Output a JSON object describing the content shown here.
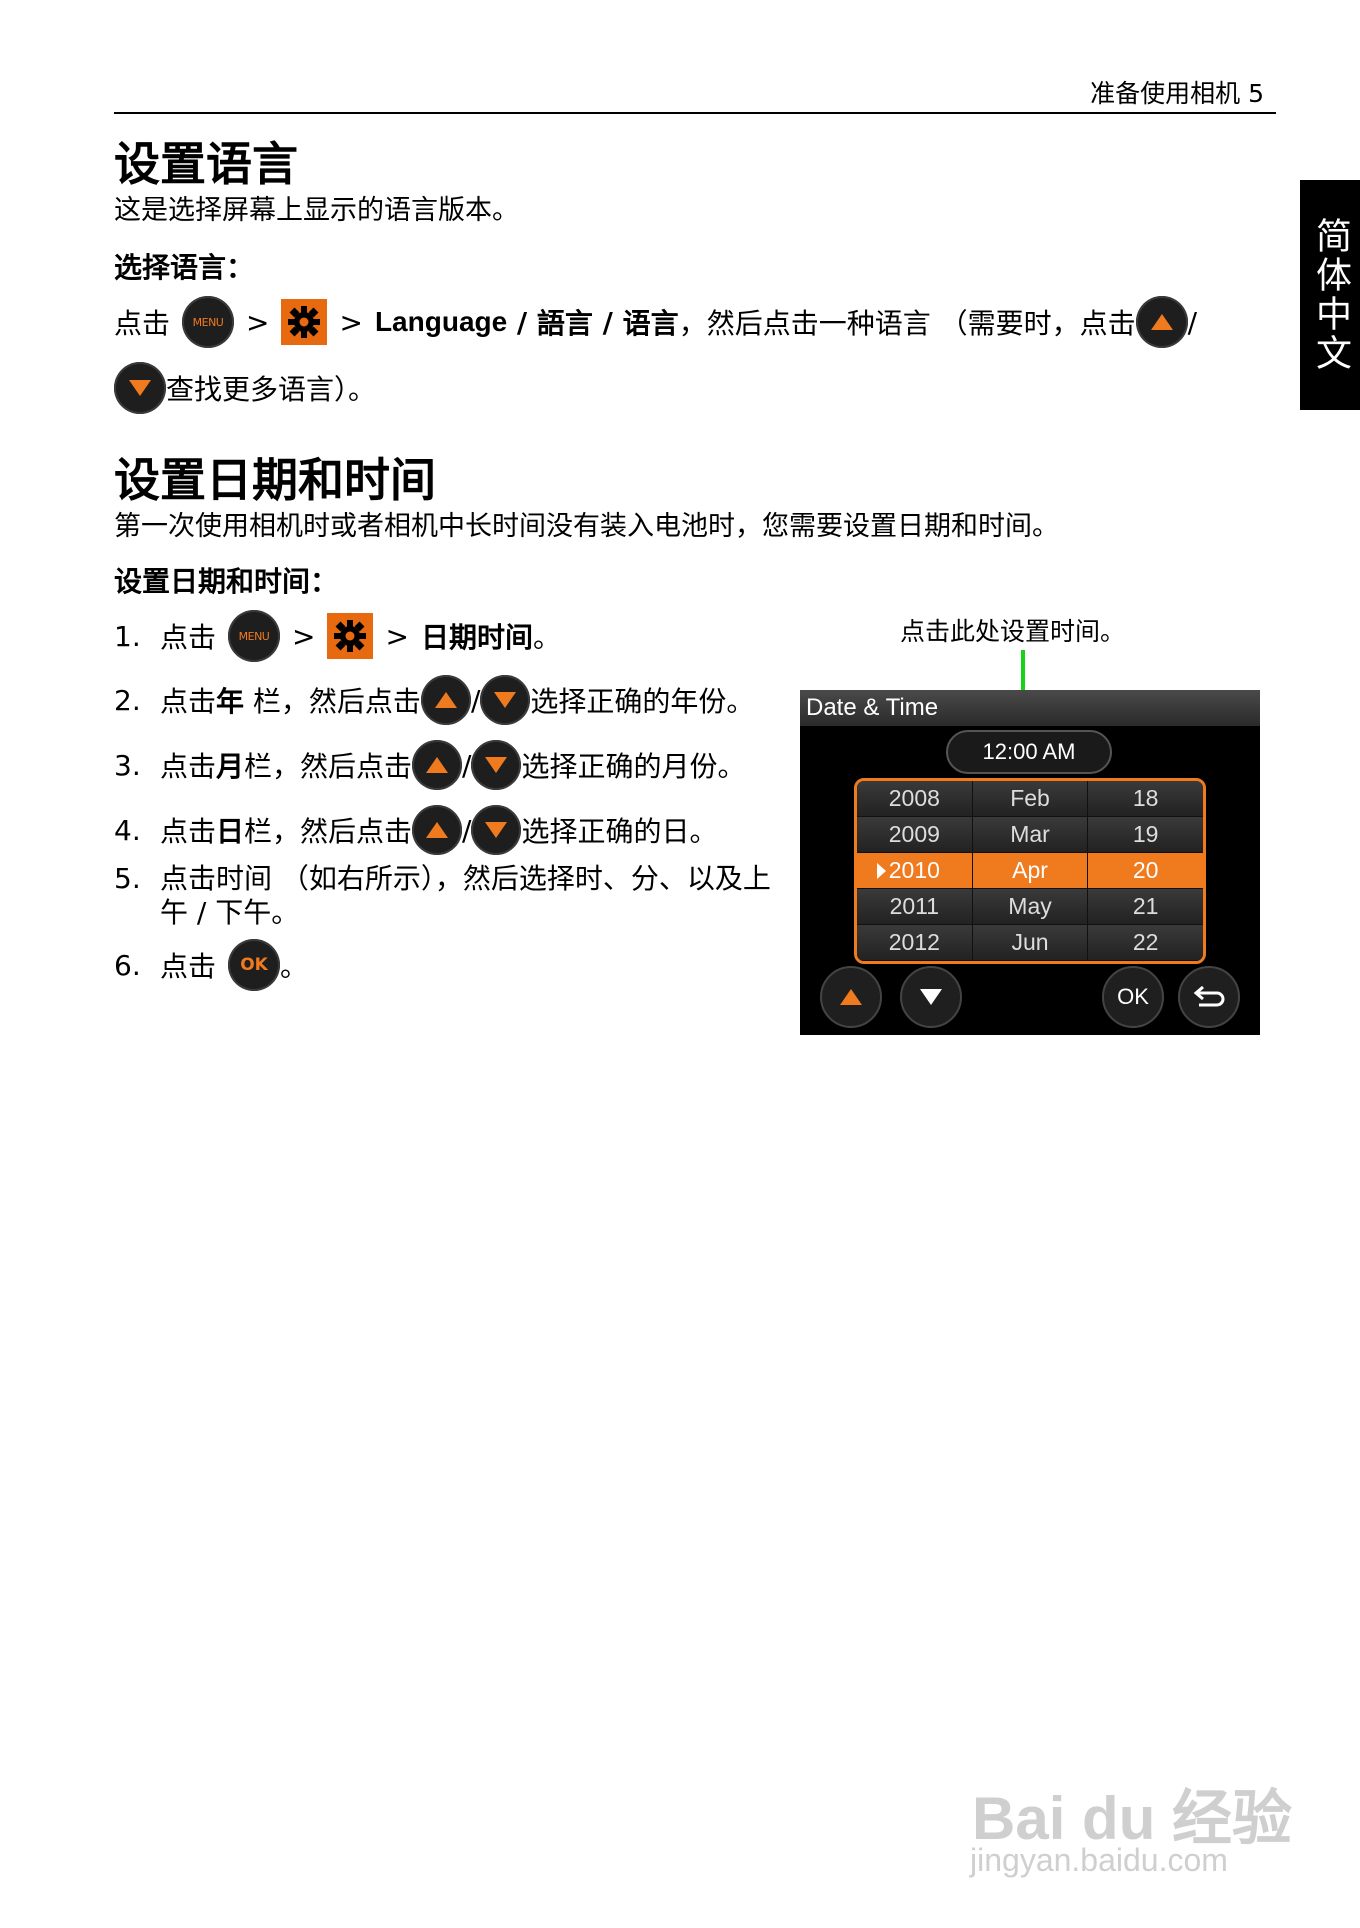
{
  "header": {
    "text": "准备使用相机  5"
  },
  "side_tab": {
    "label": "简体中文"
  },
  "section1": {
    "title": "设置语言",
    "desc": "这是选择屏幕上显示的语言版本。",
    "subheading": "选择语言：",
    "instr": {
      "click": "点击",
      "gt1": ">",
      "gt2": ">",
      "language": "Language",
      "slash1": " / ",
      "lang_trad": "語言",
      "slash2": " / ",
      "lang_simp": "语言",
      "after": "，然后点击一种语言 （需要时，点击",
      "slash3": "/",
      "line2": "查找更多语言）。"
    }
  },
  "section2": {
    "title": "设置日期和时间",
    "desc": "第一次使用相机时或者相机中长时间没有装入电池时，您需要设置日期和时间。",
    "subheading": "设置日期和时间：",
    "steps": {
      "s1": {
        "num": "1.",
        "click": "点击",
        "gt1": ">",
        "gt2": ">",
        "target": "日期时间",
        "end": "。"
      },
      "s2": {
        "num": "2.",
        "pre": "点击",
        "bold": "年",
        "mid": " 栏，然后点击",
        "slash": "/",
        "post": "选择正确的年份。"
      },
      "s3": {
        "num": "3.",
        "pre": "点击",
        "bold": "月",
        "mid": "栏，然后点击",
        "slash": "/",
        "post": "选择正确的月份。"
      },
      "s4": {
        "num": "4.",
        "pre": "点击",
        "bold": "日",
        "mid": "栏，然后点击",
        "slash": "/",
        "post": "选择正确的日。"
      },
      "s5": {
        "num": "5.",
        "line1": "点击时间 （如右所示），然后选择时、分、以及上",
        "line2": "午 / 下午。"
      },
      "s6": {
        "num": "6.",
        "click": "点击",
        "end": "。"
      }
    }
  },
  "buttons": {
    "menu": "MENU",
    "ok": "OK"
  },
  "screen": {
    "callout": "点击此处设置时间。",
    "title": "Date & Time",
    "time": "12:00 AM",
    "rows": [
      [
        "2008",
        "Feb",
        "18"
      ],
      [
        "2009",
        "Mar",
        "19"
      ],
      [
        "2010",
        "Apr",
        "20"
      ],
      [
        "2011",
        "May",
        "21"
      ],
      [
        "2012",
        "Jun",
        "22"
      ]
    ],
    "selected_row": 2,
    "ok_label": "OK"
  },
  "watermark": {
    "logo": "Bai du 经验",
    "url": "jingyan.baidu.com"
  },
  "colors": {
    "accent": "#f07a1e",
    "callout_line": "#19d119"
  }
}
